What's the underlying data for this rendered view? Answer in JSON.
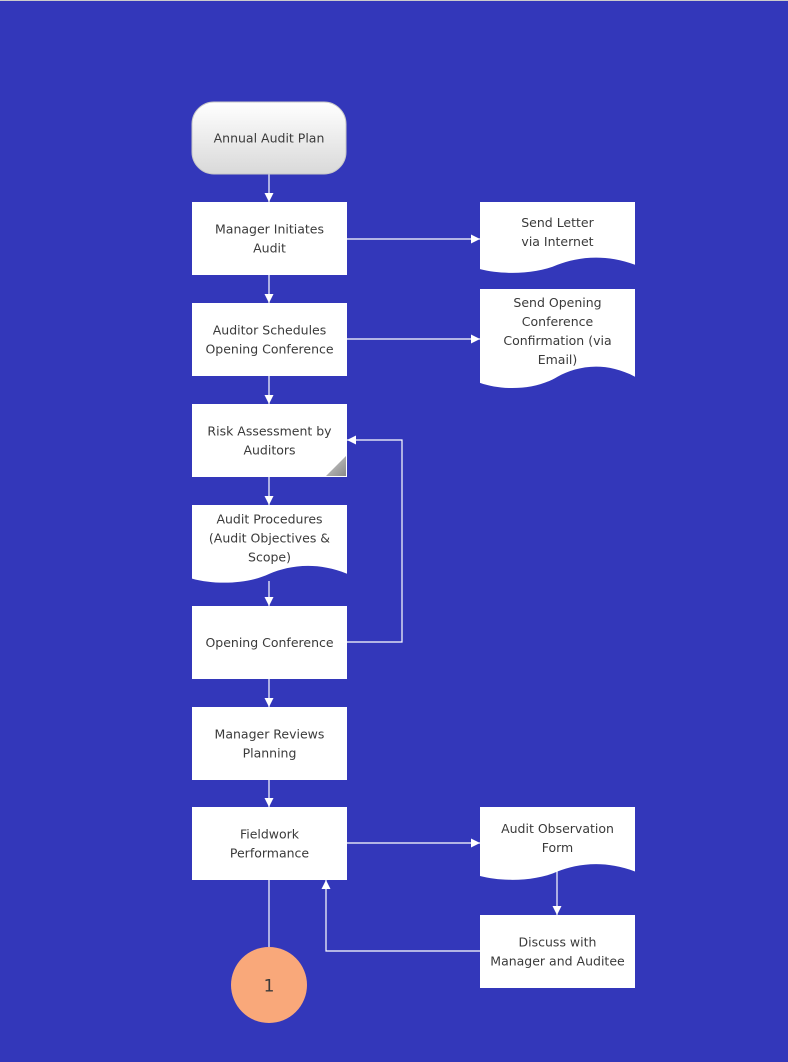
{
  "colors": {
    "background": "#3337BA",
    "box": "#FFFFFF",
    "connector": "#FFFFFF",
    "connector_circle": "#F9A87A",
    "text": "#3A3A3A"
  },
  "nodes": {
    "annual_audit_plan": {
      "shape": "terminator",
      "lines": [
        "Annual Audit Plan"
      ]
    },
    "manager_initiates": {
      "shape": "process",
      "lines": [
        "Manager Initiates",
        "Audit"
      ]
    },
    "auditor_schedules": {
      "shape": "process",
      "lines": [
        "Auditor Schedules",
        "Opening Conference"
      ]
    },
    "risk_assessment": {
      "shape": "note",
      "lines": [
        "Risk Assessment by",
        "Auditors"
      ]
    },
    "audit_procedures": {
      "shape": "document",
      "lines": [
        "Audit Procedures",
        "(Audit Objectives &",
        "Scope)"
      ]
    },
    "opening_conference": {
      "shape": "process",
      "lines": [
        "Opening Conference"
      ]
    },
    "manager_reviews": {
      "shape": "process",
      "lines": [
        "Manager Reviews",
        "Planning"
      ]
    },
    "fieldwork": {
      "shape": "process",
      "lines": [
        "Fieldwork",
        "Performance"
      ]
    },
    "send_letter": {
      "shape": "document",
      "lines": [
        "Send  Letter",
        "via Internet"
      ]
    },
    "send_opening": {
      "shape": "document",
      "lines": [
        "Send Opening",
        "Conference",
        "Confirmation (via",
        "Email)"
      ]
    },
    "audit_observation": {
      "shape": "document",
      "lines": [
        "Audit Observation",
        "Form"
      ]
    },
    "discuss": {
      "shape": "process",
      "lines": [
        "Discuss with",
        "Manager and Auditee"
      ]
    },
    "connector_1": {
      "shape": "off-page-connector",
      "lines": [
        "1"
      ]
    }
  },
  "edges": [
    {
      "from": "annual_audit_plan",
      "to": "manager_initiates"
    },
    {
      "from": "manager_initiates",
      "to": "auditor_schedules"
    },
    {
      "from": "manager_initiates",
      "to": "send_letter"
    },
    {
      "from": "auditor_schedules",
      "to": "risk_assessment"
    },
    {
      "from": "auditor_schedules",
      "to": "send_opening"
    },
    {
      "from": "risk_assessment",
      "to": "audit_procedures"
    },
    {
      "from": "audit_procedures",
      "to": "opening_conference"
    },
    {
      "from": "opening_conference",
      "to": "risk_assessment"
    },
    {
      "from": "opening_conference",
      "to": "manager_reviews"
    },
    {
      "from": "manager_reviews",
      "to": "fieldwork"
    },
    {
      "from": "fieldwork",
      "to": "audit_observation"
    },
    {
      "from": "audit_observation",
      "to": "discuss"
    },
    {
      "from": "discuss",
      "to": "fieldwork"
    },
    {
      "from": "fieldwork",
      "to": "connector_1"
    }
  ]
}
